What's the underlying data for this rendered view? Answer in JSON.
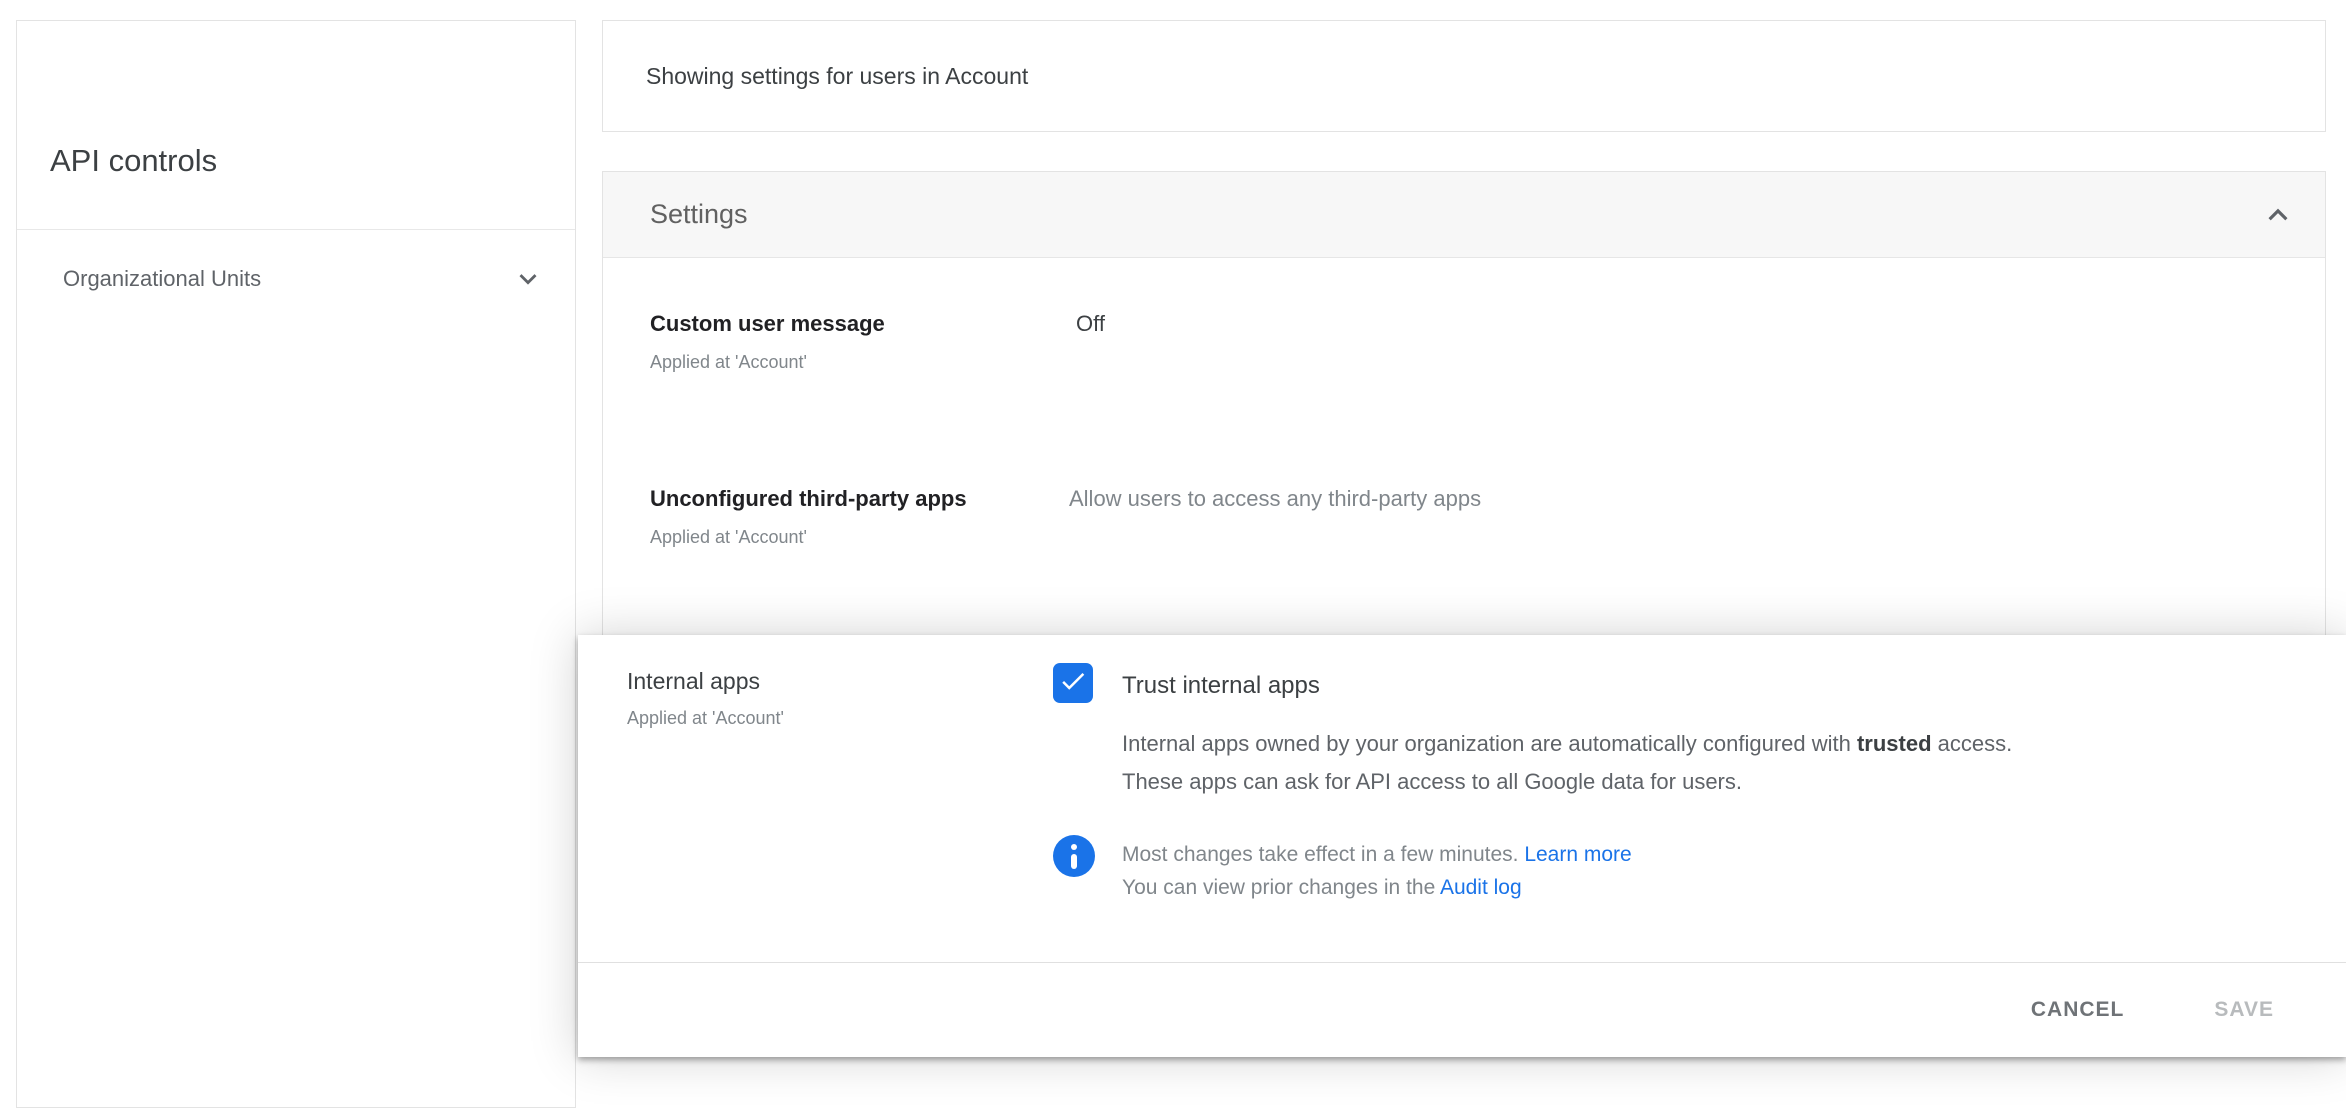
{
  "sidebar": {
    "title": "API controls",
    "items": [
      {
        "label": "Organizational Units",
        "icon": "chevron-down-icon"
      }
    ]
  },
  "header": {
    "title": "Showing settings for users in Account"
  },
  "settings": {
    "title": "Settings",
    "collapse_icon": "chevron-up-icon",
    "rows": [
      {
        "label": "Custom user message",
        "applied": "Applied at 'Account'",
        "value": "Off"
      },
      {
        "label": "Unconfigured third-party apps",
        "applied": "Applied at 'Account'",
        "value": "Allow users to access any third-party apps"
      }
    ]
  },
  "dialog": {
    "label": "Internal apps",
    "applied": "Applied at 'Account'",
    "checkbox": {
      "checked": true,
      "icon": "checkbox-checked-icon",
      "label": "Trust internal apps"
    },
    "description": {
      "line1_before": "Internal apps owned by your organization are automatically configured with ",
      "line1_bold": "trusted",
      "line1_after": " access.",
      "line2": "These apps can ask for API access to all Google data for users."
    },
    "info": {
      "icon": "info-icon",
      "line1_text": "Most changes take effect in a few minutes. ",
      "line1_link": "Learn more",
      "line2_text": "You can view prior changes in the ",
      "line2_link": "Audit log"
    },
    "buttons": {
      "cancel": "CANCEL",
      "save": "SAVE"
    }
  },
  "colors": {
    "accent_blue": "#1a73e8",
    "card_border": "#e3e3e3",
    "section_header_bg": "#f7f7f7",
    "muted_text": "#80868b",
    "body_text": "#3c4043"
  }
}
